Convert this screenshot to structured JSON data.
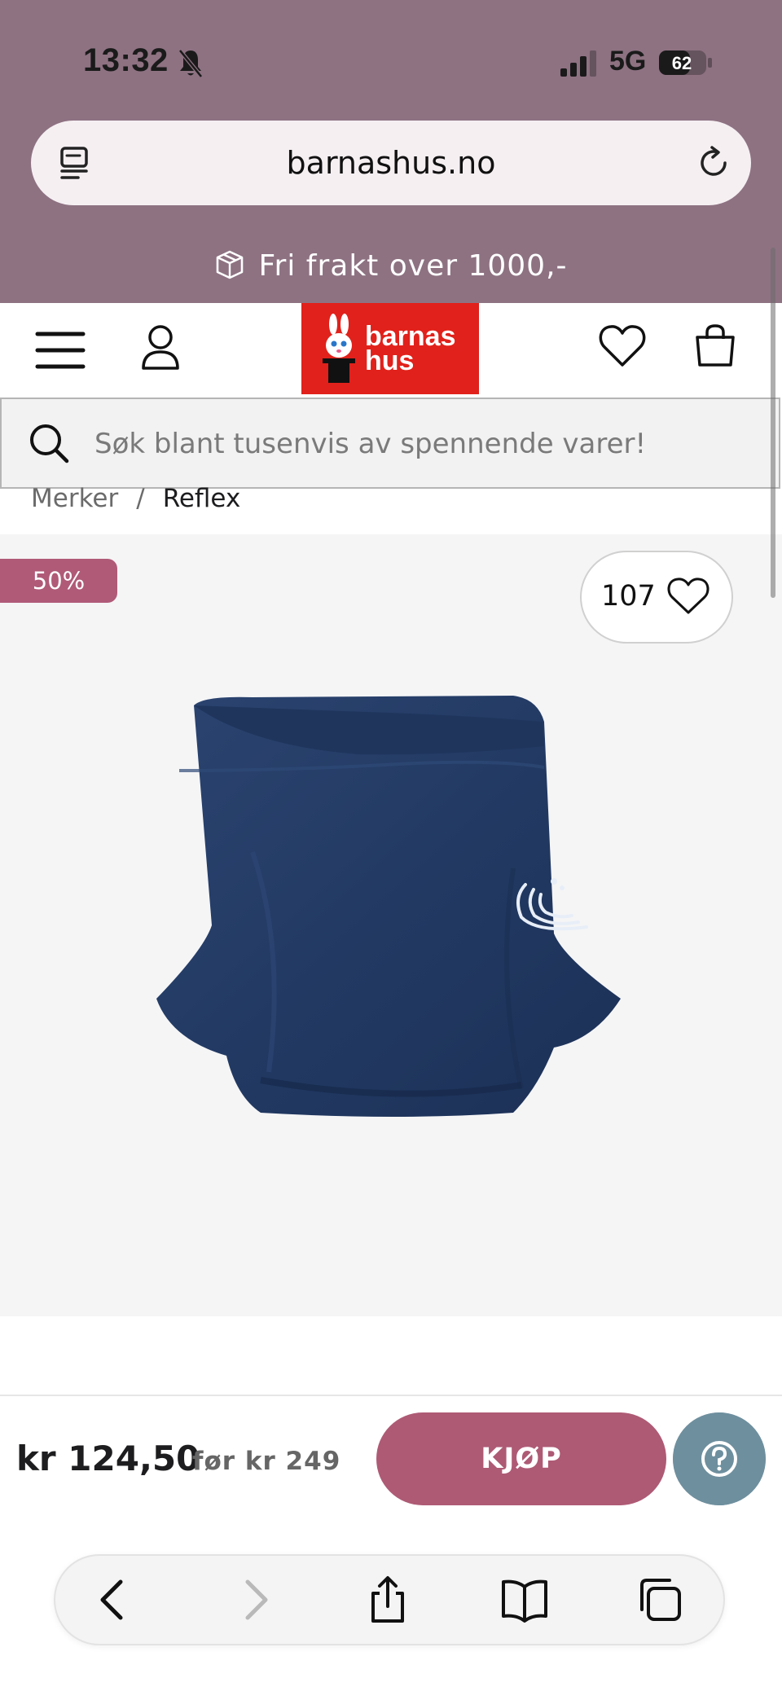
{
  "status_bar": {
    "time": "13:32",
    "network": "5G",
    "battery": "62"
  },
  "browser": {
    "url": "barnashus.no"
  },
  "promo": {
    "text": "Fri frakt over 1000,-"
  },
  "logo": {
    "line1": "barnas",
    "line2": "hus"
  },
  "search": {
    "placeholder": "Søk blant tusenvis av spennende varer!"
  },
  "breadcrumb": {
    "items": [
      "Merker",
      "Reflex"
    ],
    "separator": "/"
  },
  "product": {
    "discount_badge": "50%",
    "favorite_count": "107",
    "price": "kr 124,50",
    "old_price": "før kr 249",
    "buy_label": "KJØP"
  },
  "colors": {
    "top_bar": "#8e7282",
    "brand_red": "#e1211b",
    "accent_pink": "#ae5a75",
    "help_blue": "#6e8f9e",
    "product_navy": "#23395f"
  },
  "icons": [
    "bell-slash-icon",
    "signal-icon",
    "battery-icon",
    "tabs-icon",
    "reload-icon",
    "package-icon",
    "menu-icon",
    "user-icon",
    "heart-icon",
    "bag-icon",
    "search-icon",
    "question-icon",
    "chevron-left-icon",
    "chevron-right-icon",
    "share-icon",
    "book-icon",
    "tabs-overview-icon"
  ]
}
